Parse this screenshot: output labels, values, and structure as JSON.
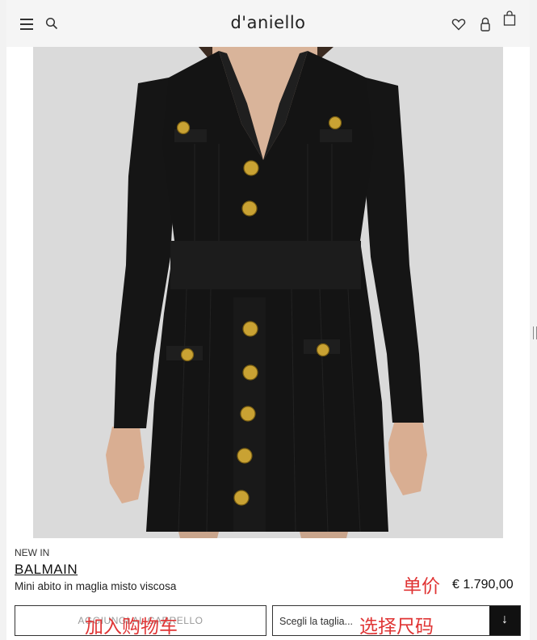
{
  "header": {
    "logo": "d'aniello",
    "icons": [
      "hamburger-menu-icon",
      "search-icon",
      "heart-icon",
      "lock-icon",
      "shopping-bag-icon"
    ]
  },
  "product": {
    "image_alt": "Black knit mini dress with gold buttons",
    "tag": "NEW IN",
    "brand": "BALMAIN",
    "description": "Mini abito in maglia misto viscosa",
    "price": "€ 1.790,00",
    "price_annotation": "单价"
  },
  "actions": {
    "add_to_cart_label": "AGGIUNGI AL CARRELLO",
    "add_to_cart_annotation": "加入购物车",
    "size_placeholder": "Scegli la taglia...",
    "size_annotation": "选择尺码",
    "size_arrow": "↓"
  },
  "colors": {
    "annotation": "#e03535",
    "dress": "#141414",
    "buttons": "#c9a233",
    "background": "#dcdcdc"
  }
}
